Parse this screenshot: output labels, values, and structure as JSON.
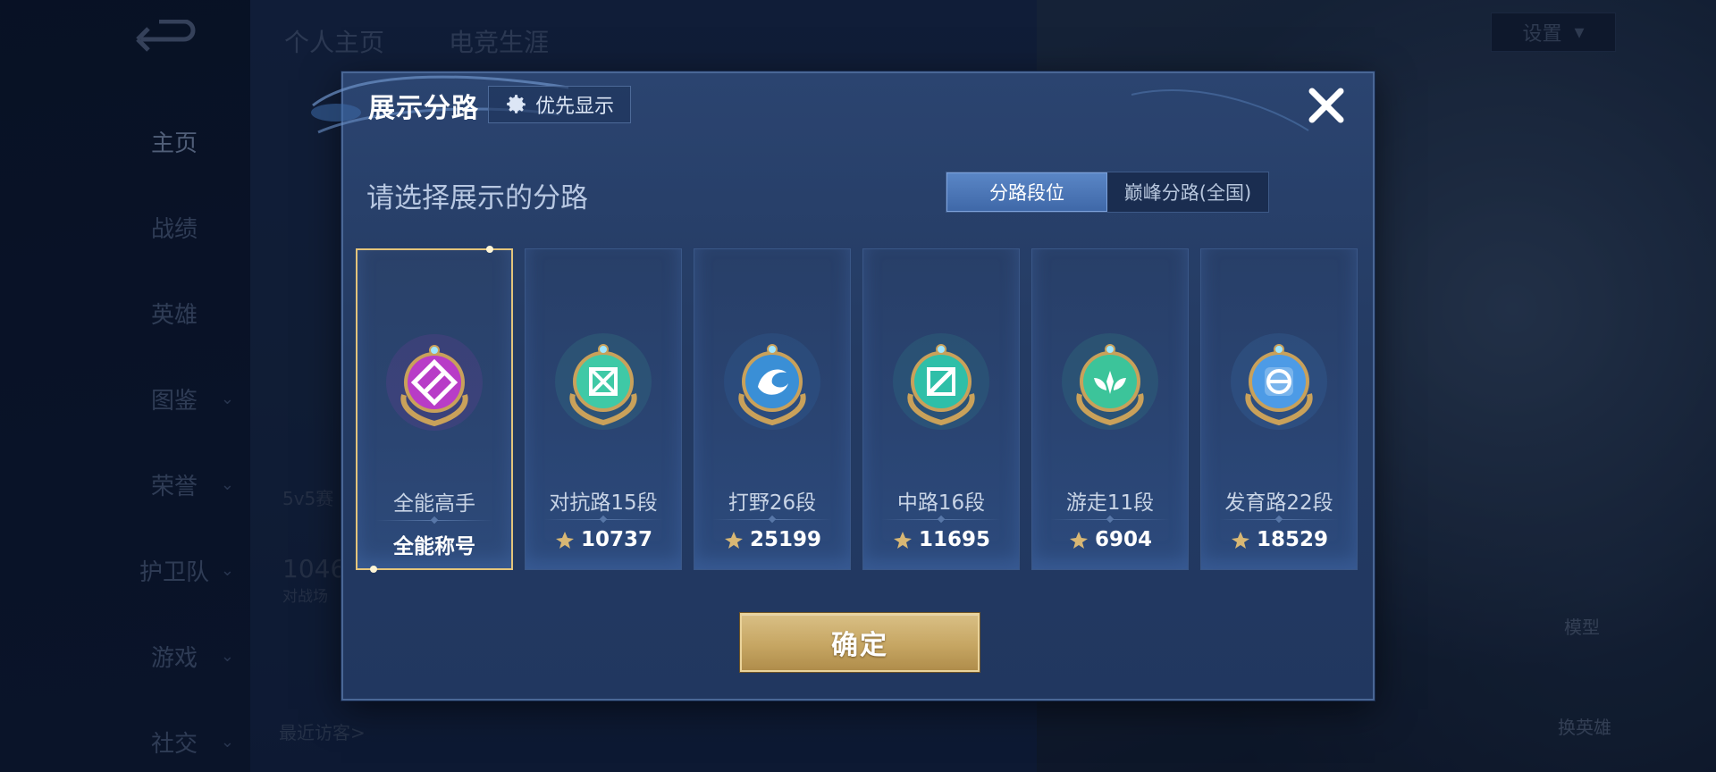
{
  "background": {
    "top_tabs": [
      "个人主页",
      "电竞生涯"
    ],
    "side_nav": [
      {
        "label": "主页",
        "has_chevron": false,
        "active": true
      },
      {
        "label": "战绩",
        "has_chevron": false,
        "active": false
      },
      {
        "label": "英雄",
        "has_chevron": false,
        "active": false
      },
      {
        "label": "图鉴",
        "has_chevron": true,
        "active": false
      },
      {
        "label": "荣誉",
        "has_chevron": true,
        "active": false
      },
      {
        "label": "护卫队",
        "has_chevron": true,
        "active": false
      },
      {
        "label": "游戏",
        "has_chevron": true,
        "active": false
      },
      {
        "label": "社交",
        "has_chevron": true,
        "active": false
      }
    ],
    "settings_label": "设置",
    "model_label": "模型",
    "change_hero_label": "换英雄",
    "recent_visitors_label": "最近访客>",
    "mode_label": "5v5赛",
    "stat_value": "1046",
    "stat_label": "对战场"
  },
  "dialog": {
    "title": "展示分路",
    "priority_button": "优先显示",
    "subtitle": "请选择展示的分路",
    "segments": [
      {
        "label": "分路段位",
        "active": true
      },
      {
        "label": "巅峰分路(全国)",
        "active": false
      }
    ],
    "cards": [
      {
        "name": "全能高手",
        "value": "全能称号",
        "show_points_icon": false,
        "selected": true,
        "badge": "allround",
        "color": "#b83cc7"
      },
      {
        "name": "对抗路15段",
        "value": "10737",
        "show_points_icon": true,
        "selected": false,
        "badge": "clash",
        "color": "#3fc9a6"
      },
      {
        "name": "打野26段",
        "value": "25199",
        "show_points_icon": true,
        "selected": false,
        "badge": "jungle",
        "color": "#3a8fd6"
      },
      {
        "name": "中路16段",
        "value": "11695",
        "show_points_icon": true,
        "selected": false,
        "badge": "mid",
        "color": "#2fbfa8"
      },
      {
        "name": "游走11段",
        "value": "6904",
        "show_points_icon": true,
        "selected": false,
        "badge": "roam",
        "color": "#3cc49a"
      },
      {
        "name": "发育路22段",
        "value": "18529",
        "show_points_icon": true,
        "selected": false,
        "badge": "farm",
        "color": "#4d9be6"
      }
    ],
    "confirm_label": "确定"
  },
  "colors": {
    "dialog_bg": "#243b63",
    "selected_border": "#e3c47b",
    "confirm_gold": "#c6a663",
    "segment_active": "#4f7abb"
  }
}
